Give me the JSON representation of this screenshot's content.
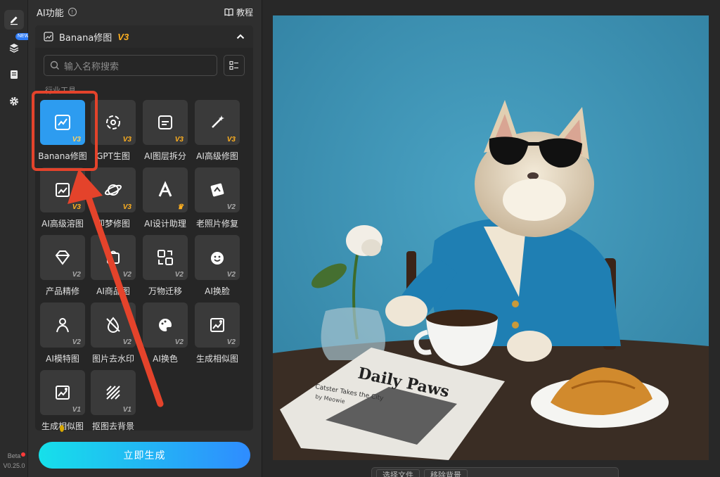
{
  "rail": {
    "new_badge": "NEW",
    "beta_label": "Beta",
    "version": "V0.25.0"
  },
  "panel": {
    "title": "AI功能",
    "tutorial_label": "教程"
  },
  "dropdown": {
    "current_tool": "Banana修图",
    "current_version": "V3",
    "search_placeholder": "输入名称搜索",
    "section_label": "行业工具"
  },
  "tools": [
    {
      "label": "Banana修图",
      "version": "V3",
      "icon": "image-edit-icon",
      "selected": true
    },
    {
      "label": "GPT生图",
      "version": "V3",
      "icon": "gpt-knot-icon"
    },
    {
      "label": "AI图层拆分",
      "version": "V3",
      "icon": "layer-split-icon"
    },
    {
      "label": "AI高级修图",
      "version": "V3",
      "icon": "magic-wand-icon"
    },
    {
      "label": "AI高级溶图",
      "version": "V3",
      "icon": "image-blend-icon"
    },
    {
      "label": "即梦修图",
      "version": "V3",
      "icon": "planet-icon"
    },
    {
      "label": "AI设计助理",
      "version": "",
      "icon": "design-assistant-icon",
      "crown": true
    },
    {
      "label": "老照片修复",
      "version": "V2",
      "icon": "photo-repair-icon"
    },
    {
      "label": "产品精修",
      "version": "V2",
      "icon": "diamond-icon"
    },
    {
      "label": "AI商品图",
      "version": "V2",
      "icon": "product-image-icon"
    },
    {
      "label": "万物迁移",
      "version": "V2",
      "icon": "transfer-icon"
    },
    {
      "label": "AI换脸",
      "version": "V2",
      "icon": "face-swap-icon"
    },
    {
      "label": "AI模特图",
      "version": "V2",
      "icon": "model-person-icon"
    },
    {
      "label": "图片去水印",
      "version": "V2",
      "icon": "watermark-remove-icon"
    },
    {
      "label": "AI换色",
      "version": "V2",
      "icon": "color-palette-icon"
    },
    {
      "label": "生成相似图",
      "version": "V2",
      "icon": "similar-image-icon"
    },
    {
      "label": "生成相似图",
      "version": "V1",
      "icon": "similar-image-icon"
    },
    {
      "label": "抠图去背景",
      "version": "V1",
      "icon": "cutout-icon"
    }
  ],
  "generate_label": "立即生成",
  "photo": {
    "newspaper_title": "Daily Paws",
    "newspaper_headline": "Catster Takes the City",
    "newspaper_byline": "by Meowie"
  },
  "bottom_bar": {
    "select_file": "选择文件",
    "remove_background": "移除背景"
  },
  "colors": {
    "accent_gradient_start": "#16e0ea",
    "accent_gradient_end": "#2f8cff",
    "selected_tile": "#2d9cf0",
    "version_badge": "#ffb020",
    "highlight": "#e4432b"
  }
}
